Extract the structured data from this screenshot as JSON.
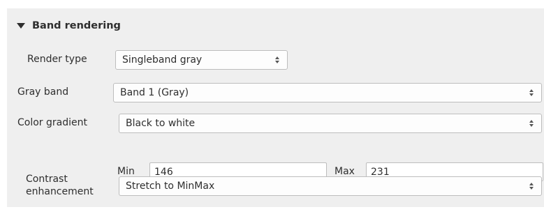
{
  "section": {
    "title": "Band rendering",
    "collapse_icon": "triangle-down-icon"
  },
  "render_type": {
    "label": "Render type",
    "value": "Singleband gray"
  },
  "gray_band": {
    "label": "Gray band",
    "value": "Band 1 (Gray)"
  },
  "color_gradient": {
    "label": "Color gradient",
    "value": "Black to white"
  },
  "min": {
    "label": "Min",
    "value": "146"
  },
  "max": {
    "label": "Max",
    "value": "231"
  },
  "contrast": {
    "label_line1": "Contrast",
    "label_line2": "enhancement",
    "value": "Stretch to MinMax"
  },
  "colors": {
    "panel_bg": "#efefef",
    "field_bg": "#ffffff",
    "border": "#bdbdbd",
    "text": "#2e2e2e"
  }
}
